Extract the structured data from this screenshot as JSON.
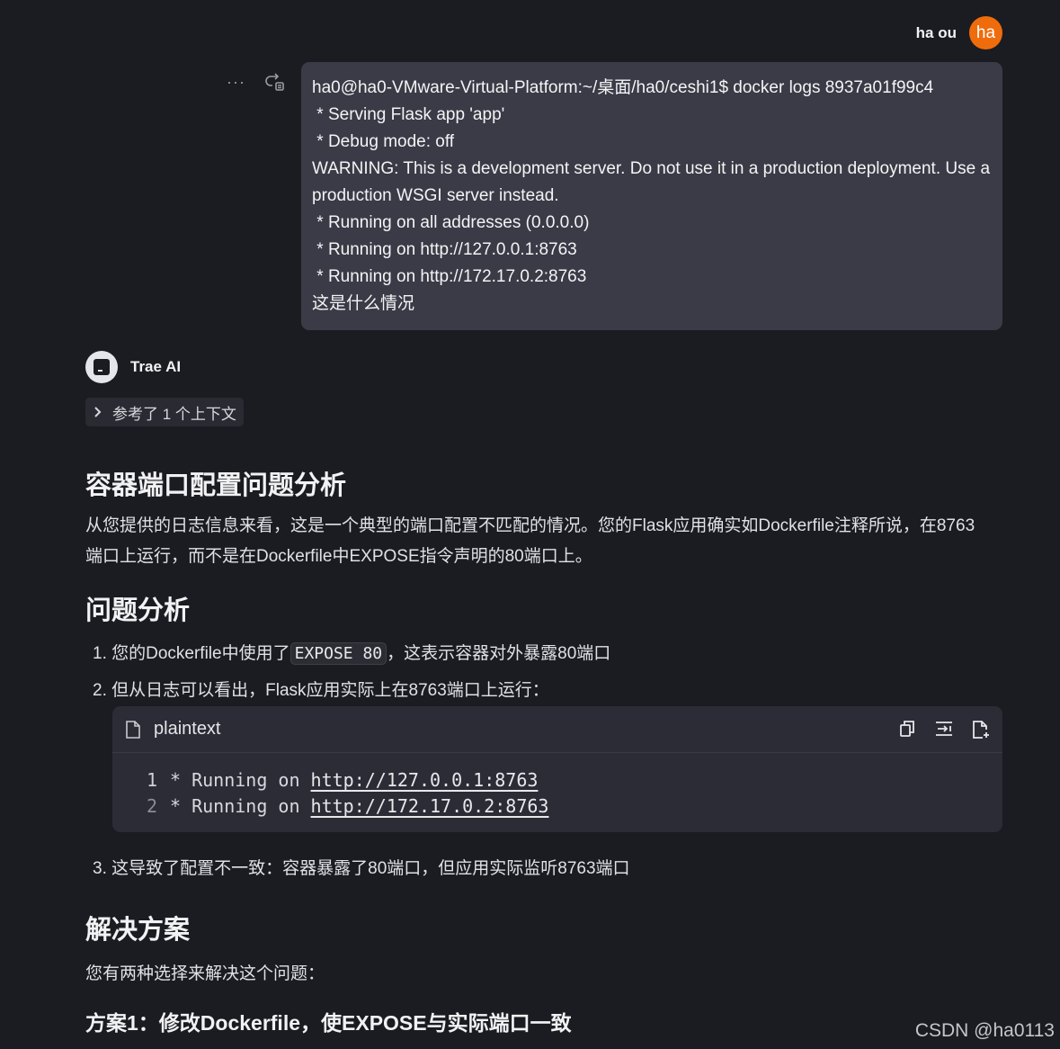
{
  "user": {
    "name": "ha ou",
    "avatar_text": "ha",
    "avatar_color": "#ef6c0c"
  },
  "user_message": {
    "lines": [
      "ha0@ha0-VMware-Virtual-Platform:~/桌面/ha0/ceshi1$ docker logs 8937a01f99c4",
      " * Serving Flask app 'app'",
      " * Debug mode: off",
      "WARNING: This is a development server. Do not use it in a production deployment. Use a production WSGI server instead.",
      " * Running on all addresses (0.0.0.0)",
      " * Running on http://127.0.0.1:8763",
      " * Running on http://172.17.0.2:8763",
      "这是什么情况"
    ],
    "actions": [
      "more-icon",
      "retry-icon"
    ]
  },
  "assistant": {
    "name": "Trae AI",
    "context_chip": "参考了 1 个上下文"
  },
  "content": {
    "heading_main": "容器端口配置问题分析",
    "intro": "从您提供的日志信息来看，这是一个典型的端口配置不匹配的情况。您的Flask应用确实如Dockerfile注释所说，在8763端口上运行，而不是在Dockerfile中EXPOSE指令声明的80端口上。",
    "heading_problem": "问题分析",
    "item1_prefix": "1. 您的Dockerfile中使用了",
    "item1_code": "EXPOSE 80",
    "item1_suffix": "，这表示容器对外暴露80端口",
    "item2": "2. 但从日志可以看出，Flask应用实际上在8763端口上运行：",
    "code_block": {
      "language": "plaintext",
      "lines": [
        {
          "num": "1",
          "prefix": "* Running on ",
          "url": "http://127.0.0.1:8763"
        },
        {
          "num": "2",
          "prefix": "* Running on ",
          "url": "http://172.17.0.2:8763"
        }
      ],
      "tools": [
        "copy-icon",
        "insert-icon",
        "apply-file-icon"
      ]
    },
    "item3": "3. 这导致了配置不一致：容器暴露了80端口，但应用实际监听8763端口",
    "heading_solution": "解决方案",
    "choice": "您有两种选择来解决这个问题：",
    "heading_plan1": "方案1：修改Dockerfile，使EXPOSE与实际端口一致"
  },
  "watermark": "CSDN @ha0113"
}
